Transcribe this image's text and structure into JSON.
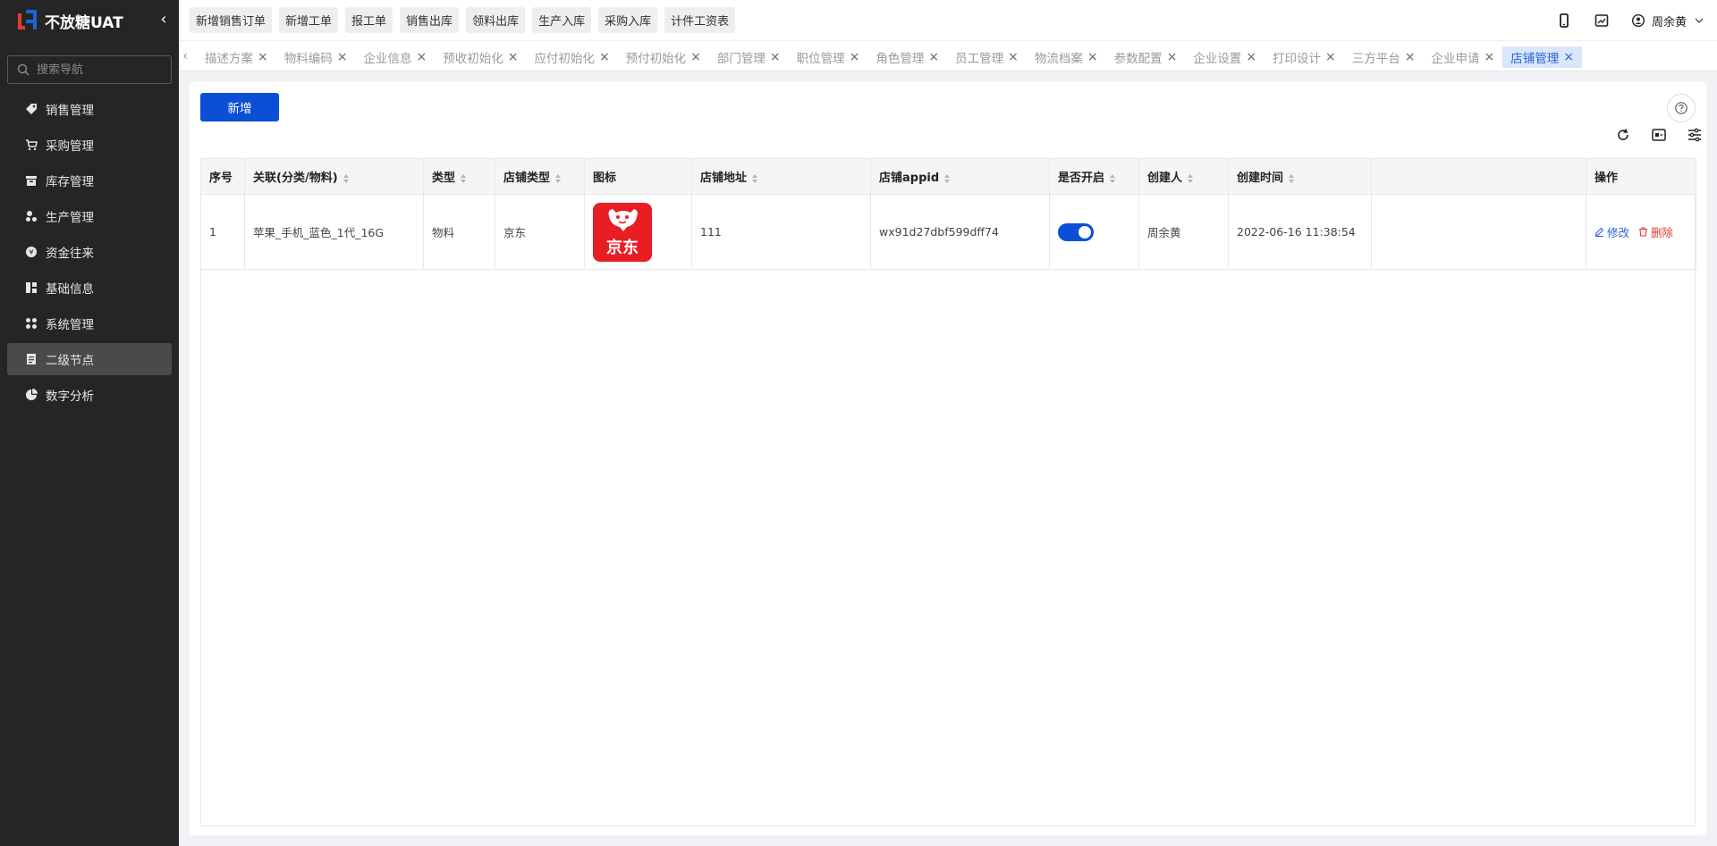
{
  "app": {
    "name": "不放糖UAT"
  },
  "sidebar": {
    "search_placeholder": "搜索导航",
    "items": [
      {
        "label": "销售管理",
        "icon": "tag-icon"
      },
      {
        "label": "采购管理",
        "icon": "cart-icon"
      },
      {
        "label": "库存管理",
        "icon": "box-icon"
      },
      {
        "label": "生产管理",
        "icon": "factory-icon"
      },
      {
        "label": "资金往来",
        "icon": "coin-icon"
      },
      {
        "label": "基础信息",
        "icon": "chart-icon"
      },
      {
        "label": "系统管理",
        "icon": "grid-icon"
      },
      {
        "label": "二级节点",
        "icon": "document-icon"
      },
      {
        "label": "数字分析",
        "icon": "pie-icon"
      }
    ],
    "active_index": 7
  },
  "topbar": {
    "quick": [
      "新增销售订单",
      "新增工单",
      "报工单",
      "销售出库",
      "领料出库",
      "生产入库",
      "采购入库",
      "计件工资表"
    ],
    "user": "周余黄"
  },
  "tabs": {
    "items": [
      "描述方案",
      "物料编码",
      "企业信息",
      "预收初始化",
      "应付初始化",
      "预付初始化",
      "部门管理",
      "职位管理",
      "角色管理",
      "员工管理",
      "物流档案",
      "参数配置",
      "企业设置",
      "打印设计",
      "三方平台",
      "企业申请",
      "店铺管理"
    ],
    "close": "×",
    "active_index": 16
  },
  "toolbar": {
    "add_label": "新增"
  },
  "table": {
    "headers": [
      "序号",
      "关联(分类/物料)",
      "类型",
      "店铺类型",
      "图标",
      "店铺地址",
      "店铺appid",
      "是否开启",
      "创建人",
      "创建时间",
      "",
      "操作"
    ],
    "rows": [
      {
        "index": "1",
        "related": "苹果_手机_蓝色_1代_16G",
        "type": "物料",
        "shop_type": "京东",
        "icon_text": "京东",
        "address": "111",
        "appid": "wx91d27dbf599dff74",
        "enabled": true,
        "creator": "周余黄",
        "created_at": "2022-06-16 11:38:54",
        "edit": "修改",
        "delete": "删除"
      }
    ]
  },
  "colors": {
    "primary": "#0a4fd6",
    "danger": "#e53935",
    "sidebar_bg": "#252525"
  }
}
